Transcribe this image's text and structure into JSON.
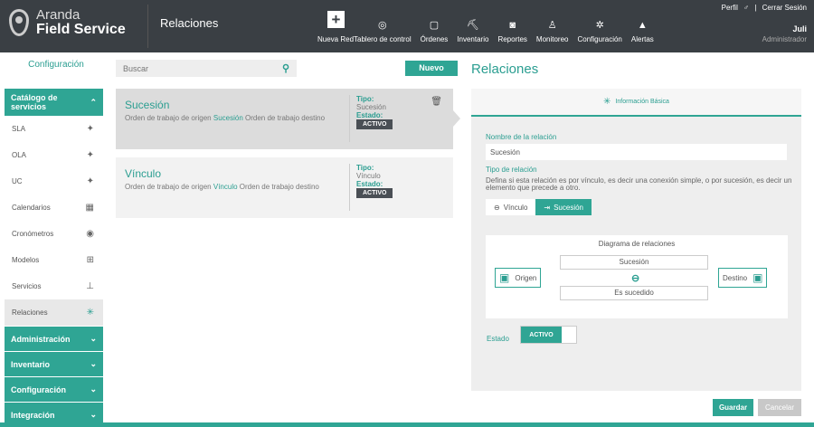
{
  "brand": {
    "line1": "Aranda",
    "line2": "Field Service"
  },
  "header": {
    "page_title": "Relaciones",
    "nav": [
      {
        "label": "Nueva Red",
        "icon": "plus-icon"
      },
      {
        "label": "Tablero de control",
        "icon": "dashboard-icon",
        "glyph": "◎"
      },
      {
        "label": "Órdenes",
        "icon": "orders-icon",
        "glyph": "▢"
      },
      {
        "label": "Inventario",
        "icon": "inventory-icon",
        "glyph": "⛏"
      },
      {
        "label": "Reportes",
        "icon": "reports-icon",
        "glyph": "◙"
      },
      {
        "label": "Monitoreo",
        "icon": "monitor-icon",
        "glyph": "♙"
      },
      {
        "label": "Configuración",
        "icon": "gear-icon",
        "glyph": "✲"
      },
      {
        "label": "Alertas",
        "icon": "bell-icon",
        "glyph": "🔔"
      }
    ],
    "user": {
      "profile": "Perfil",
      "logout": "Cerrar Sesión",
      "name": "Juli",
      "role": "Administrador"
    }
  },
  "sidebar": {
    "title": "Configuración",
    "catalog": "Catálogo de servicios",
    "items": [
      {
        "label": "SLA",
        "icon": "handshake-icon",
        "glyph": "🤝"
      },
      {
        "label": "OLA",
        "icon": "handshake-icon",
        "glyph": "🤝"
      },
      {
        "label": "UC",
        "icon": "handshake-icon",
        "glyph": "🤝"
      },
      {
        "label": "Calendarios",
        "icon": "calendar-icon",
        "glyph": "▦"
      },
      {
        "label": "Cronómetros",
        "icon": "stopwatch-icon",
        "glyph": "⏱"
      },
      {
        "label": "Modelos",
        "icon": "models-icon",
        "glyph": "⊞"
      },
      {
        "label": "Servicios",
        "icon": "services-icon",
        "glyph": "⚒"
      },
      {
        "label": "Relaciones",
        "icon": "relations-icon",
        "glyph": "✳"
      }
    ],
    "groups": [
      "Administración",
      "Inventario",
      "Configuración",
      "Integración"
    ]
  },
  "search": {
    "placeholder": "Buscar"
  },
  "new_button": "Nuevo",
  "list": [
    {
      "title": "Sucesión",
      "desc_pre": "Orden de trabajo de origen",
      "desc_hl": "Sucesión",
      "desc_post": "Orden de trabajo destino",
      "tipo_label": "Tipo:",
      "tipo": "Sucesión",
      "estado_label": "Estado:",
      "estado": "ACTIVO"
    },
    {
      "title": "Vínculo",
      "desc_pre": "Orden de trabajo de origen",
      "desc_hl": "Vínculo",
      "desc_post": "Orden de trabajo destino",
      "tipo_label": "Tipo:",
      "tipo": "Vínculo",
      "estado_label": "Estado:",
      "estado": "ACTIVO"
    }
  ],
  "detail": {
    "title": "Relaciones",
    "tab": "Información Básica",
    "name_label": "Nombre de la relación",
    "name_value": "Sucesión",
    "type_label": "Tipo de relación",
    "type_help": "Defina si esta relación es por vínculo, es decir una conexión simple, o por sucesión, es decir un elemento que precede a otro.",
    "type_options": [
      "Vínculo",
      "Sucesión"
    ],
    "diagram": {
      "title": "Diagrama de relaciones",
      "origin": "Origen",
      "dest": "Destino",
      "top": "Sucesión",
      "bottom": "Es sucedido"
    },
    "estado_label": "Estado",
    "estado_value": "ACTIVO"
  },
  "actions": {
    "save": "Guardar",
    "cancel": "Cancelar"
  },
  "colors": {
    "accent": "#2fa594",
    "header": "#3a3f44"
  }
}
